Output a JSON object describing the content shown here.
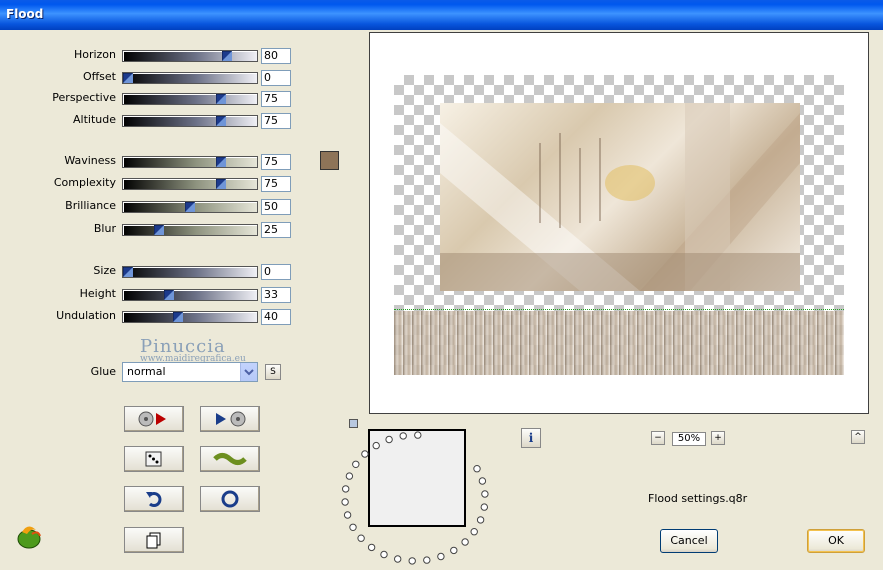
{
  "window": {
    "title": "Flood"
  },
  "sliders": [
    {
      "label": "Horizon",
      "value": "80"
    },
    {
      "label": "Offset",
      "value": "0"
    },
    {
      "label": "Perspective",
      "value": "75"
    },
    {
      "label": "Altitude",
      "value": "75"
    },
    {
      "label": "Waviness",
      "value": "75"
    },
    {
      "label": "Complexity",
      "value": "75"
    },
    {
      "label": "Brilliance",
      "value": "50"
    },
    {
      "label": "Blur",
      "value": "25"
    },
    {
      "label": "Size",
      "value": "0"
    },
    {
      "label": "Height",
      "value": "33"
    },
    {
      "label": "Undulation",
      "value": "40"
    }
  ],
  "glue": {
    "label": "Glue",
    "value": "normal",
    "s_button": "S"
  },
  "watermark": {
    "line1": "Pinuccia",
    "line2": "www.maidiregrafica.eu"
  },
  "color_swatch": "#8E7458",
  "zoom": {
    "minus": "−",
    "value": "50%",
    "plus": "+"
  },
  "info_icon": "i",
  "collapse_icon": "^",
  "settings_file": "Flood settings.q8r",
  "buttons": {
    "cancel": "Cancel",
    "ok": "OK"
  },
  "icons": [
    "load-preset-icon",
    "save-preset-icon",
    "random-dice-icon",
    "wave-icon",
    "reset-icon",
    "default-icon",
    "copy-icon",
    "filter-logo-icon"
  ]
}
